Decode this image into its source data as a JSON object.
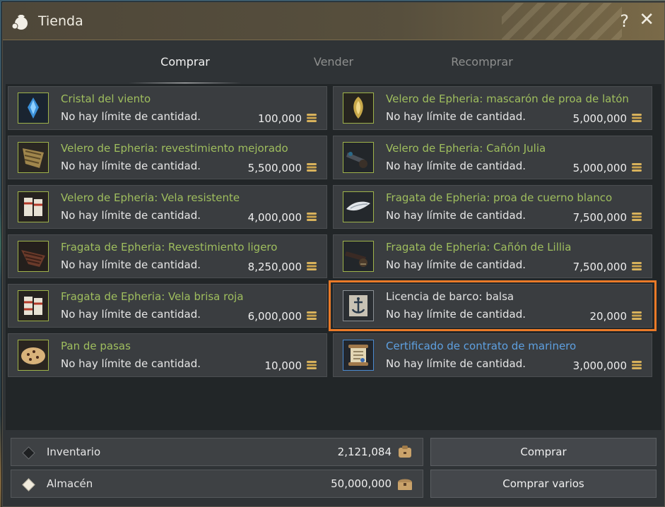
{
  "window": {
    "title": "Tienda"
  },
  "titlebar": {
    "help": "?",
    "close": "✕"
  },
  "tabs": [
    {
      "label": "Comprar",
      "active": true
    },
    {
      "label": "Vender",
      "active": false
    },
    {
      "label": "Recomprar",
      "active": false
    }
  ],
  "items": [
    {
      "name": "Cristal del viento",
      "limit": "No hay límite de cantidad.",
      "price": "100,000",
      "icon": "wind-crystal-icon",
      "name_color": "green"
    },
    {
      "name": "Velero de Epheria: mascarón de proa de latón",
      "limit": "No hay límite de cantidad.",
      "price": "5,000,000",
      "icon": "brass-figurehead-icon",
      "name_color": "green"
    },
    {
      "name": "Velero de Epheria: revestimiento mejorado",
      "limit": "No hay límite de cantidad.",
      "price": "5,500,000",
      "icon": "plating-icon",
      "name_color": "green"
    },
    {
      "name": "Velero de Epheria: Cañón Julia",
      "limit": "No hay límite de cantidad.",
      "price": "5,000,000",
      "icon": "cannon-icon",
      "name_color": "green"
    },
    {
      "name": "Velero de Epheria: Vela resistente",
      "limit": "No hay límite de cantidad.",
      "price": "4,000,000",
      "icon": "sail-icon",
      "name_color": "green"
    },
    {
      "name": "Fragata de Epheria: proa de cuerno blanco",
      "limit": "No hay límite de cantidad.",
      "price": "7,500,000",
      "icon": "white-horn-prow-icon",
      "name_color": "green"
    },
    {
      "name": "Fragata de Epheria: Revestimiento ligero",
      "limit": "No hay límite de cantidad.",
      "price": "8,250,000",
      "icon": "light-plating-icon",
      "name_color": "green"
    },
    {
      "name": "Fragata de Epheria: Cañón de Lillia",
      "limit": "No hay límite de cantidad.",
      "price": "7,500,000",
      "icon": "cannon-icon",
      "name_color": "green"
    },
    {
      "name": "Fragata de Epheria: Vela brisa roja",
      "limit": "No hay límite de cantidad.",
      "price": "6,000,000",
      "icon": "sail-icon",
      "name_color": "green"
    },
    {
      "name": "Licencia de barco: balsa",
      "limit": "No hay límite de cantidad.",
      "price": "20,000",
      "icon": "anchor-license-icon",
      "name_color": "white",
      "selected": true
    },
    {
      "name": "Pan de pasas",
      "limit": "No hay límite de cantidad.",
      "price": "10,000",
      "icon": "raisin-bread-icon",
      "name_color": "green"
    },
    {
      "name": "Certificado de contrato de marinero",
      "limit": "No hay límite de cantidad.",
      "price": "3,000,000",
      "icon": "scroll-contract-icon",
      "name_color": "blue"
    }
  ],
  "footer": {
    "inventory": {
      "label": "Inventario",
      "value": "2,121,084"
    },
    "storage": {
      "label": "Almacén",
      "value": "50,000,000"
    },
    "buy_label": "Comprar",
    "buy_multiple_label": "Comprar varios"
  },
  "colors": {
    "highlight": "#ea7a28",
    "item_name_green": "#9fbe5e",
    "item_name_blue": "#5ea0e0",
    "coin": "#d8b25c"
  }
}
